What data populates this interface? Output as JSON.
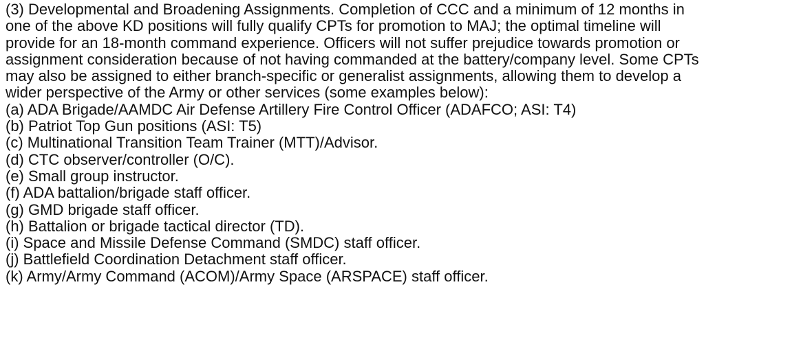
{
  "document": {
    "paragraph_lines": [
      "(3) Developmental and Broadening Assignments. Completion of CCC and a minimum of 12 months in",
      "one of the above KD positions will fully qualify CPTs for promotion to MAJ; the optimal timeline will",
      "provide for an 18-month command experience. Officers will not suffer prejudice towards promotion or",
      "assignment consideration because of not having commanded at the battery/company level. Some CPTs",
      "may also be assigned to either branch-specific or generalist assignments, allowing them to develop a",
      "wider perspective of the Army or other services (some examples below):"
    ],
    "items": [
      "(a) ADA Brigade/AAMDC Air Defense Artillery Fire Control Officer (ADAFCO; ASI: T4)",
      "(b) Patriot Top Gun positions (ASI: T5)",
      "(c) Multinational Transition Team Trainer (MTT)/Advisor.",
      "(d) CTC observer/controller (O/C).",
      "(e) Small group instructor.",
      "(f) ADA battalion/brigade staff officer.",
      "(g) GMD brigade staff officer.",
      "(h) Battalion or brigade tactical director (TD).",
      "(i) Space and Missile Defense Command (SMDC) staff officer.",
      "(j) Battlefield Coordination Detachment staff officer.",
      "(k) Army/Army Command (ACOM)/Army Space (ARSPACE) staff officer."
    ]
  }
}
